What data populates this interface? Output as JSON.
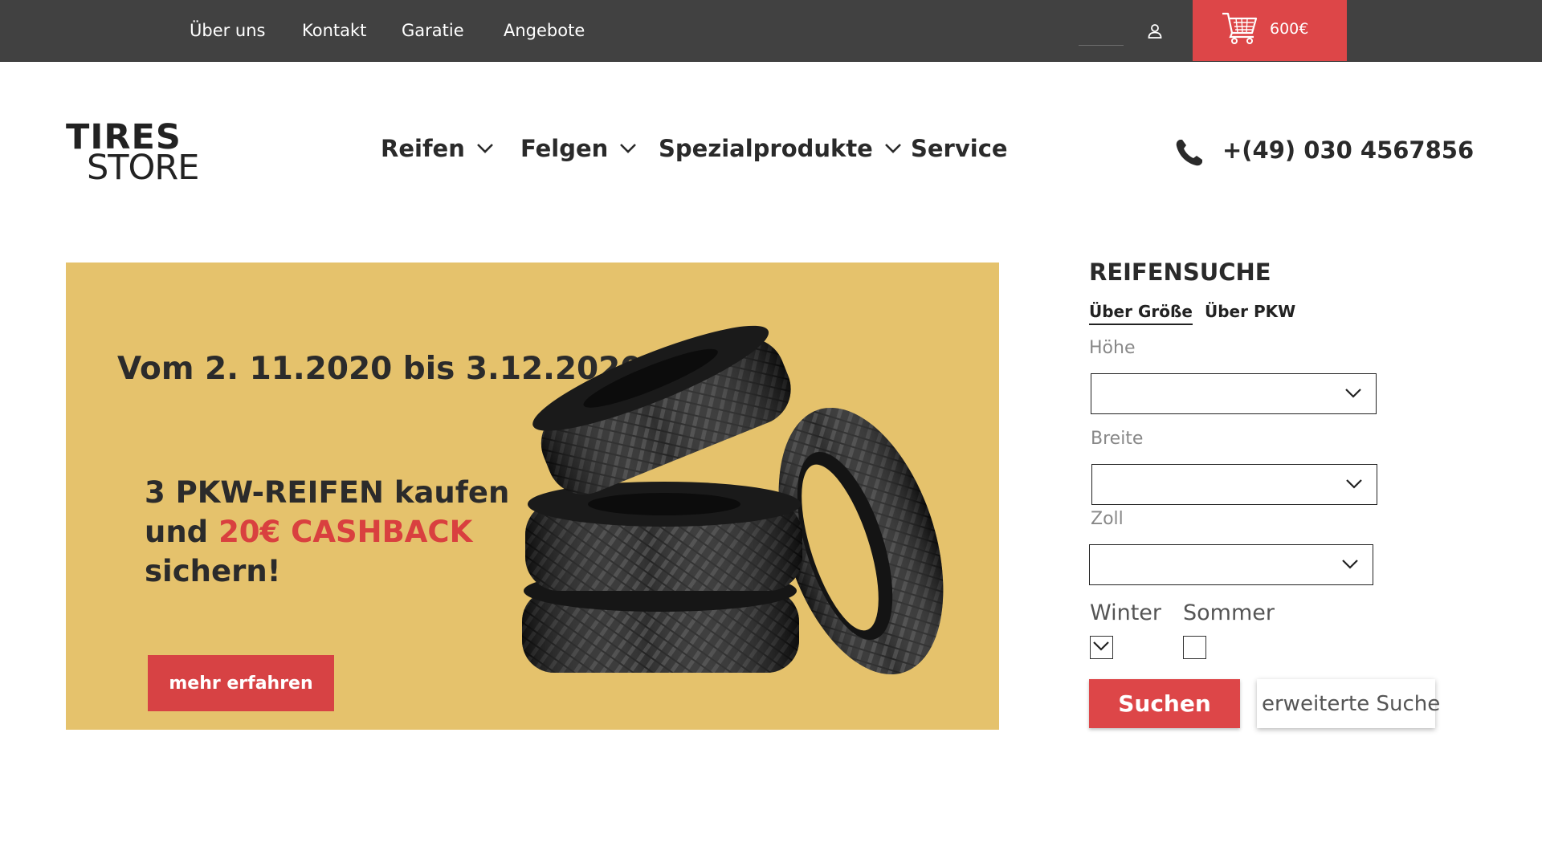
{
  "topbar": {
    "links": [
      "Über uns",
      "Kontakt",
      "Garatie",
      "Angebote"
    ],
    "cart_total": "600€"
  },
  "logo": {
    "line1": "TIRES",
    "line2": "STORE"
  },
  "nav": {
    "items": [
      {
        "label": "Reifen",
        "has_dropdown": true
      },
      {
        "label": "Felgen",
        "has_dropdown": true
      },
      {
        "label": "Spezialprodukte",
        "has_dropdown": true
      },
      {
        "label": "Service",
        "has_dropdown": false
      }
    ],
    "phone": "+(49) 030 4567856"
  },
  "hero": {
    "date_range": "Vom 2. 11.2020 bis 3.12.2020",
    "offer_line1": "3 PKW-REIFEN kaufen",
    "offer_line2_prefix": "und ",
    "offer_highlight": "20€ CASHBACK",
    "offer_line3": "sichern!",
    "button_label": "mehr erfahren"
  },
  "search": {
    "title": "REIFENSUCHE",
    "tabs": [
      {
        "label": "Über Größe",
        "active": true
      },
      {
        "label": "Über PKW",
        "active": false
      }
    ],
    "fields": [
      {
        "label": "Höhe",
        "value": ""
      },
      {
        "label": "Breite",
        "value": ""
      },
      {
        "label": "Zoll",
        "value": ""
      }
    ],
    "seasons": [
      {
        "label": "Winter",
        "checked": true
      },
      {
        "label": "Sommer",
        "checked": false
      }
    ],
    "submit_label": "Suchen",
    "advanced_label": "erweiterte Suche"
  },
  "colors": {
    "topbar_bg": "#414141",
    "accent_red": "#dd4648",
    "hero_bg": "#e5c26c",
    "text_dark": "#2a2a2a"
  },
  "icons": [
    "user-icon",
    "cart-icon",
    "chevron-down-icon",
    "phone-icon",
    "checkmark-icon"
  ]
}
